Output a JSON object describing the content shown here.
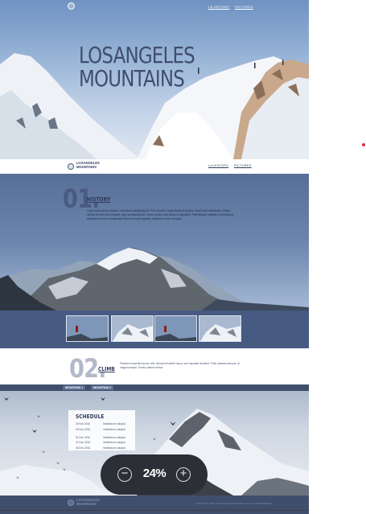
{
  "hero": {
    "nav": [
      "LA HISTORY",
      "PICTURES"
    ],
    "title_line1": "LOSANGELES",
    "title_line2": "MOUNTAINS"
  },
  "header": {
    "logo_line1": "LOSANGELES",
    "logo_line2": "MOUNTAINS",
    "nav": [
      "LA HISTORY",
      "PICTURES"
    ]
  },
  "history": {
    "number": "01.",
    "label": "HISTORY",
    "text": "Lorem ipsum dolor sit amet, consectetur adipiscing elit. Proin at enim a turpis tincidunt gravida. Mauris sed malesuada. Nullam lobortis leo sed erat interdum, eget consequat justo. Donec porttitor sed ipsum eu dignissim. Pellentesque habitant morbi tristique senectus et netus et malesuada fames ac turpis egestas. Aliquam ut ante non ligula."
  },
  "climb": {
    "number": "02.",
    "label": "CLIMB",
    "text": "Praesent imperdiet auctor velit. Aenean hendrerit lacus, sed vulputate tincidunt. Proin pharetra tempus, at magna semper. Donec pretium metus."
  },
  "tabs": [
    "MOUNTAIN 1",
    "MOUNTAIN 2"
  ],
  "schedule": {
    "title": "SCHEDULE",
    "rows": [
      {
        "date": "29 Nov 2016",
        "text": "Vestibulum volutpat"
      },
      {
        "date": "30 Nov 2016",
        "text": "Vestibulum volutpat"
      },
      {
        "date": "01 Dec 2016",
        "text": "Vestibulum volutpat"
      },
      {
        "date": "02 Dec 2016",
        "text": "Vestibulum volutpat"
      },
      {
        "date": "05 Dec 2016",
        "text": "Vestibulum volutpat"
      }
    ]
  },
  "footer": {
    "logo_line1": "LOSANGELES",
    "logo_line2": "MOUNTAINS",
    "copyright": "COPYRIGHT 2016 LOSANGELES MOUNTAINS. ALL RIGHTS RESERVED."
  },
  "zoom": {
    "value": "24%",
    "minus_icon": "−",
    "plus_icon": "+"
  },
  "colors": {
    "navy": "#404e6d",
    "band": "#465a82",
    "zoom_bg": "#2c3036"
  }
}
